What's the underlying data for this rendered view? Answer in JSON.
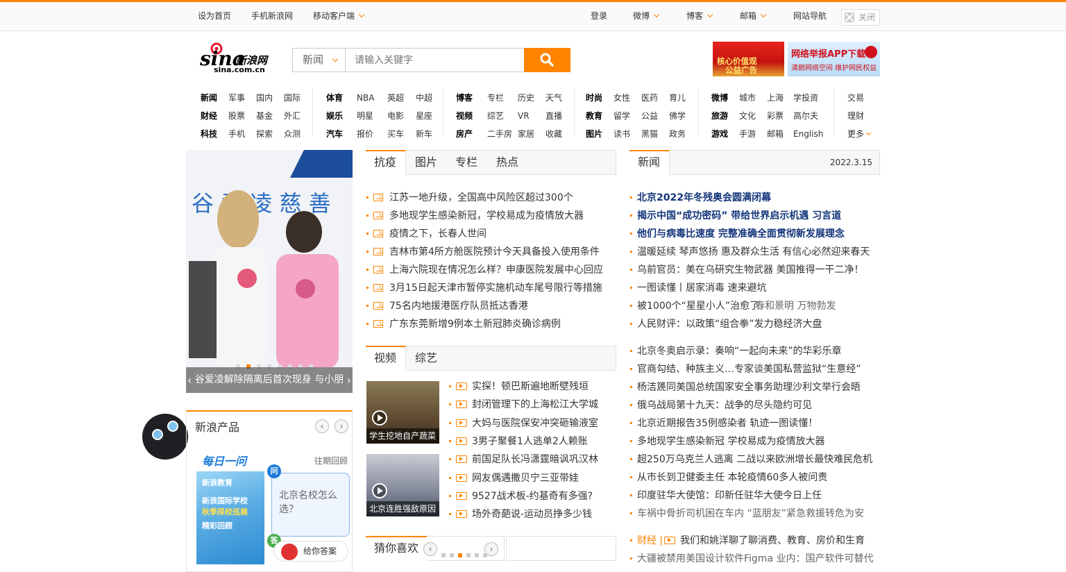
{
  "topbar": {
    "set_home": "设为首页",
    "mobile_sina": "手机新浪网",
    "mobile_client": "移动客户端",
    "login": "登录",
    "weibo": "微博",
    "blog": "博客",
    "mail": "邮箱",
    "site_nav": "网站导航",
    "close": "关闭"
  },
  "logo": {
    "brand": "sina",
    "brand_cn": "新浪网",
    "domain": "sina.com.cn"
  },
  "search": {
    "category": "新浪",
    "category_display": "新闻",
    "placeholder": "请输入关键字"
  },
  "ads": {
    "ad1_line1": "核心价值观",
    "ad1_line2": "公益广告",
    "ad2_line1": "网络举报APP下载",
    "ad2_line2": "清朗网络空间  维护网民权益"
  },
  "nav": {
    "col1": [
      [
        "新闻",
        "军事",
        "国内",
        "国际"
      ],
      [
        "财经",
        "股票",
        "基金",
        "外汇"
      ],
      [
        "科技",
        "手机",
        "探索",
        "众测"
      ]
    ],
    "col2": [
      [
        "体育",
        "NBA",
        "英超",
        "中超"
      ],
      [
        "娱乐",
        "明星",
        "电影",
        "星座"
      ],
      [
        "汽车",
        "报价",
        "买车",
        "新车"
      ]
    ],
    "col3": [
      [
        "博客",
        "专栏",
        "历史",
        "天气"
      ],
      [
        "视频",
        "综艺",
        "VR",
        "直播"
      ],
      [
        "房产",
        "二手房",
        "家居",
        "收藏"
      ]
    ],
    "col4": [
      [
        "时尚",
        "女性",
        "医药",
        "育儿"
      ],
      [
        "教育",
        "留学",
        "公益",
        "佛学"
      ],
      [
        "图片",
        "读书",
        "黑猫",
        "政务"
      ]
    ],
    "col5": [
      [
        "微博",
        "城市",
        "上海",
        "学投资"
      ],
      [
        "旅游",
        "文化",
        "彩票",
        "高尔夫"
      ],
      [
        "游戏",
        "手游",
        "邮箱",
        "English"
      ]
    ],
    "col6": [
      "交易",
      "理财",
      "更多"
    ]
  },
  "slide": {
    "caption": "谷爱凌解除隔离后首次现身 与小朋",
    "banner_text": "谷 爱 凌 慈 善",
    "active_index": 2,
    "count": 8
  },
  "products": {
    "title": "新浪产品",
    "daily": "每日一问",
    "past": "往期回顾",
    "img_line1": "新浪教育",
    "img_line2": "新浪国际学校",
    "img_line3": "秋季择校巡展",
    "img_line4": "精彩回顾",
    "question": "北京名校怎么选？",
    "q_badge": "问",
    "a_badge": "答",
    "answer_btn": "给你答案"
  },
  "epidemic": {
    "tabs": [
      "抗疫",
      "图片",
      "专栏",
      "热点"
    ],
    "items": [
      "江苏一地升级，全国高中风险区超过300个",
      "多地现学生感染新冠，学校易成为疫情放大器",
      "疫情之下，长春人世间",
      "吉林市第4所方舱医院预计今天具备投入使用条件",
      "上海六院现在情况怎么样？申康医院发展中心回应",
      "3月15日起天津市暂停实施机动车尾号限行等措施",
      "75名内地援港医疗队员抵达香港",
      "广东东莞新增9例本土新冠肺炎确诊病例"
    ]
  },
  "video": {
    "tabs": [
      "视频",
      "综艺"
    ],
    "thumb1_caption": "学生挖地自产蔬菜",
    "thumb2_caption": "北京连胜强敌原因",
    "items": [
      "实探！顿巴斯遍地断壁残垣",
      "封闭管理下的上海松江大学城",
      "大妈与医院保安冲突砸输液室",
      "3男子聚餐1人逃单2人赖账",
      "前国足队长冯潇霆暗讽巩汉林",
      "网友偶遇撒贝宁三亚带娃",
      "9527战术板-约基奇有多强?",
      "场外奇葩说-运动员挣多少钱"
    ]
  },
  "guess": {
    "title": "猜你喜欢",
    "active_index": 3,
    "count": 6
  },
  "news": {
    "tab": "新闻",
    "date": "2022.3.15",
    "headlines": [
      "北京2022年冬残奥会圆满闭幕",
      "揭示中国“成功密码” 带给世界启示机遇 习言道",
      "他们与病毒比速度 完整准确全面贯彻新发展理念"
    ],
    "group1": [
      "温暖延续 琴声悠扬 惠及群众生活 有信心必然迎来春天",
      "乌前官员：美在乌研究生物武器 美国推得一干二净！",
      "一图读懂丨居家消毒 速来避坑"
    ],
    "line7_a": "被1000个“星星小人”治愈了",
    "line7_b": "春和景明 万物勃发",
    "line8": "人民财评：以政策“组合拳”发力稳经济大盘",
    "group2": [
      "北京冬奥启示录：奏响“一起向未来”的华彩乐章",
      "官商勾结、种族主义…专家谈美国私营监狱“生意经”",
      "杨洁篪同美国总统国家安全事务助理沙利文举行会晤",
      "俄乌战局第十九天：战争的尽头隐约可见",
      "北京近期报告35例感染者 轨迹一图读懂！",
      "多地现学生感染新冠 学校易成为疫情放大器",
      "超250万乌克兰人逃离 二战以来欧洲增长最快难民危机",
      "从市长到卫健委主任 本轮疫情60多人被问责",
      "印度驻华大使馆：印新任驻华大使今日上任",
      "车祸中骨折司机困在车内 “蓝朋友”紧急救援转危为安"
    ],
    "finance_label": "财经 |",
    "finance_item": "我们和姚洋聊了聊消费、教育、房价和生育",
    "last_item": "大疆被禁用美国设计软件Figma 业内：国产软件可替代"
  },
  "colors": {
    "accent": "#ff8400",
    "headline": "#13347a"
  }
}
